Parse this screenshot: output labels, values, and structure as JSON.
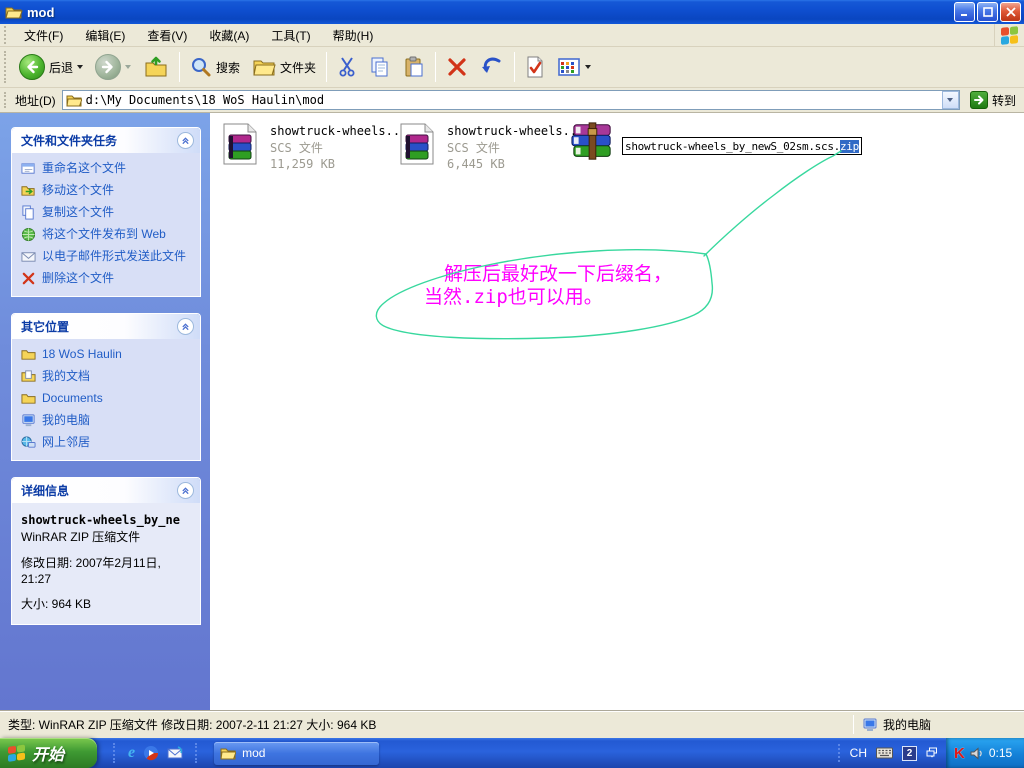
{
  "window": {
    "title": "mod"
  },
  "menubar": {
    "items": [
      "文件(F)",
      "编辑(E)",
      "查看(V)",
      "收藏(A)",
      "工具(T)",
      "帮助(H)"
    ]
  },
  "toolbar": {
    "back_label": "后退",
    "search_label": "搜索",
    "folders_label": "文件夹"
  },
  "addressbar": {
    "label": "地址(D)",
    "path": "d:\\My Documents\\18 WoS Haulin\\mod",
    "go_label": "转到"
  },
  "sidebar": {
    "file_tasks": {
      "title": "文件和文件夹任务",
      "items": [
        {
          "label": "重命名这个文件"
        },
        {
          "label": "移动这个文件"
        },
        {
          "label": "复制这个文件"
        },
        {
          "label": "将这个文件发布到 Web"
        },
        {
          "label": "以电子邮件形式发送此文件"
        },
        {
          "label": "删除这个文件"
        }
      ]
    },
    "other_places": {
      "title": "其它位置",
      "items": [
        {
          "label": "18 WoS Haulin"
        },
        {
          "label": "我的文档"
        },
        {
          "label": "Documents"
        },
        {
          "label": "我的电脑"
        },
        {
          "label": "网上邻居"
        }
      ]
    },
    "details": {
      "title": "详细信息",
      "filename": "showtruck-wheels_by_ne",
      "filetype": "WinRAR ZIP 压缩文件",
      "modified_line1": "修改日期: 2007年2月11日,",
      "modified_line2": "21:27",
      "size": "大小: 964 KB"
    }
  },
  "files": [
    {
      "name": "showtruck-wheels...",
      "type": "SCS 文件",
      "size": "11,259 KB"
    },
    {
      "name": "showtruck-wheels...",
      "type": "SCS 文件",
      "size": "6,445 KB"
    }
  ],
  "rename": {
    "plain": "showtruck-wheels_by_newS_02sm.scs.",
    "selected": "zip"
  },
  "annotation": {
    "line1": "解压后最好改一下后缀名，",
    "line2": "当然.zip也可以用。",
    "text_color": "#ff00ff",
    "stroke_color": "#38d89e"
  },
  "statusbar": {
    "info": "类型: WinRAR ZIP 压缩文件 修改日期: 2007-2-11 21:27 大小: 964 KB",
    "zone": "我的电脑"
  },
  "taskbar": {
    "start_label": "开始",
    "task_button": "mod",
    "tray": {
      "lang": "CH",
      "time": "0:15"
    }
  },
  "icons": {
    "ie_glyph": "e",
    "kaspersky_glyph": "K",
    "ime_glyph": "2"
  },
  "colors": {
    "selection": "#316ac5",
    "link": "#215dc6",
    "titlebar": "#0f4fd0",
    "taskbar": "#2a63dd"
  }
}
